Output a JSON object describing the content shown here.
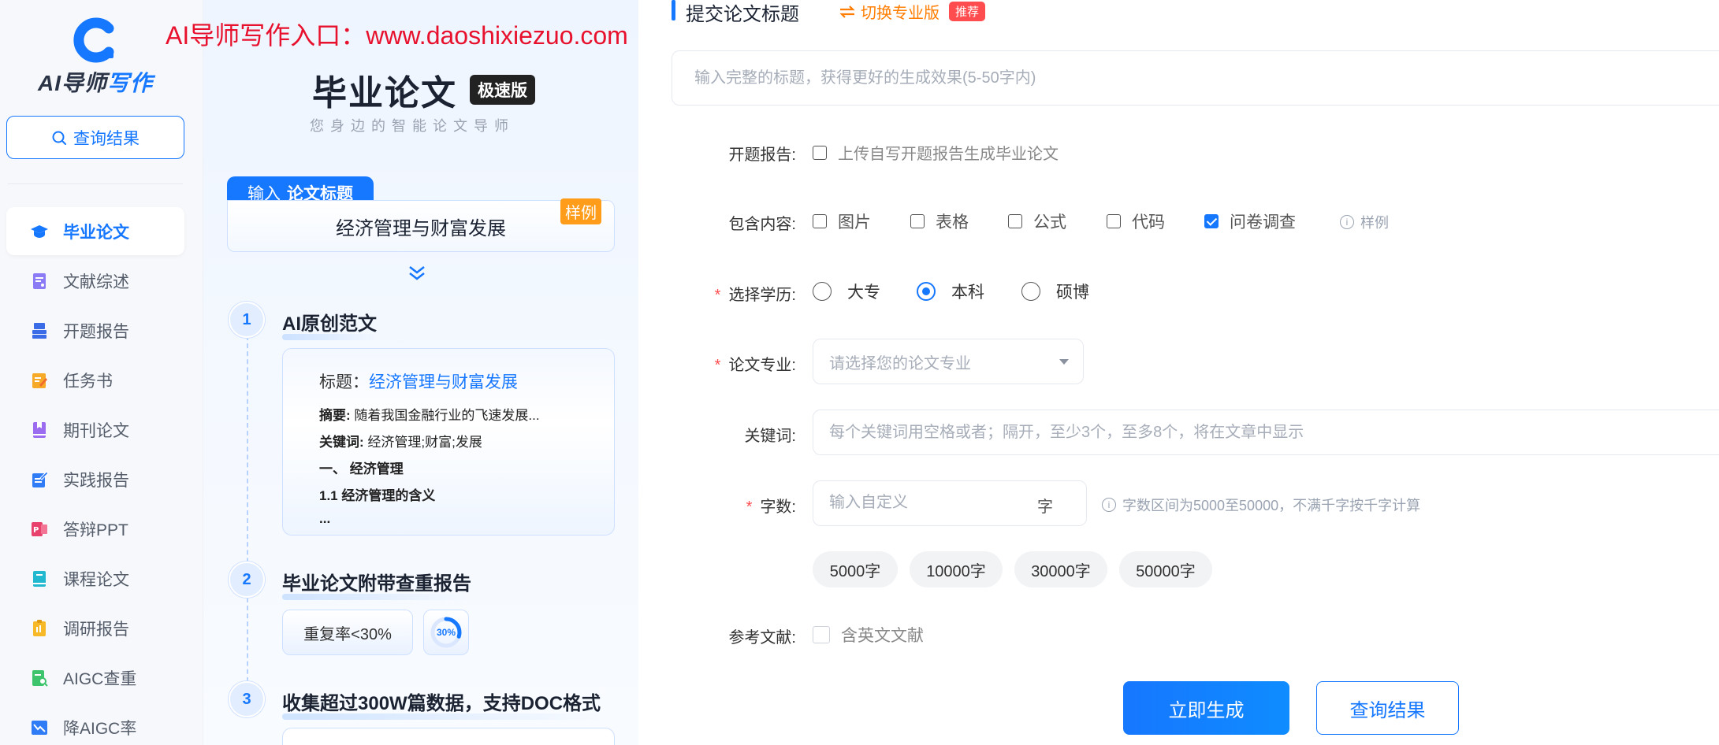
{
  "brand": {
    "logo_text_main": "AI导师",
    "logo_text_accent": "写作",
    "accent_color": "#1677ff"
  },
  "watermark": "AI导师写作入口：www.daoshixiezuo.com",
  "sidebar": {
    "query_button": "查询结果",
    "items": [
      {
        "label": "毕业论文",
        "icon": "graduation-cap-icon",
        "active": true
      },
      {
        "label": "文献综述",
        "icon": "document-list-icon"
      },
      {
        "label": "开题报告",
        "icon": "stack-report-icon"
      },
      {
        "label": "任务书",
        "icon": "task-edit-icon"
      },
      {
        "label": "期刊论文",
        "icon": "journal-book-icon"
      },
      {
        "label": "实践报告",
        "icon": "practice-edit-icon"
      },
      {
        "label": "答辩PPT",
        "icon": "ppt-icon"
      },
      {
        "label": "课程论文",
        "icon": "course-book-icon"
      },
      {
        "label": "调研报告",
        "icon": "clipboard-icon"
      },
      {
        "label": "AIGC查重",
        "icon": "aigc-check-icon"
      },
      {
        "label": "降AIGC率",
        "icon": "chart-down-icon"
      }
    ]
  },
  "promo": {
    "title": "毕业论文",
    "badge": "极速版",
    "subtitle": "您身边的智能论文导师",
    "input_tab_prefix": "输入",
    "input_tab_bold": "论文标题",
    "example_title": "经济管理与财富发展",
    "sample_tag": "样例",
    "steps": [
      {
        "num": "1",
        "title": "AI原创范文"
      },
      {
        "num": "2",
        "title": "毕业论文附带查重报告"
      },
      {
        "num": "3",
        "title": "收集超过300W篇数据，支持DOC格式"
      }
    ],
    "article": {
      "title_label": "标题：",
      "title_value": "经济管理与财富发展",
      "abstract_label": "摘要:",
      "abstract_value": "随着我国金融行业的飞速发展...",
      "keywords_label": "关键词:",
      "keywords_value": "经济管理;财富;发展",
      "heading1": "一、 经济管理",
      "heading2": "1.1 经济管理的含义",
      "ellipsis": "..."
    },
    "rate_text": "重复率<30%",
    "rate_ring_label": "30%",
    "rate_ring_value": 0.3
  },
  "form": {
    "section_title": "提交论文标题",
    "switch_label": "切换专业版",
    "recommend_badge": "推荐",
    "title_placeholder": "输入完整的标题，获得更好的生成效果(5-50字内)",
    "proposal": {
      "label": "开题报告:",
      "option": "上传自写开题报告生成毕业论文"
    },
    "contents": {
      "label": "包含内容:",
      "options": [
        {
          "label": "图片",
          "checked": false
        },
        {
          "label": "表格",
          "checked": false
        },
        {
          "label": "公式",
          "checked": false
        },
        {
          "label": "代码",
          "checked": false
        },
        {
          "label": "问卷调查",
          "checked": true
        }
      ],
      "example_link": "样例"
    },
    "degree": {
      "label": "选择学历:",
      "options": [
        "大专",
        "本科",
        "硕博"
      ],
      "selected": "本科"
    },
    "major": {
      "label": "论文专业:",
      "placeholder": "请选择您的论文专业"
    },
    "keywords": {
      "label": "关键词:",
      "placeholder": "每个关键词用空格或者；隔开，至少3个，至多8个，将在文章中显示"
    },
    "word_count": {
      "label": "字数:",
      "placeholder": "输入自定义",
      "unit": "字",
      "hint": "字数区间为5000至50000，不满千字按千字计算",
      "presets": [
        "5000字",
        "10000字",
        "30000字",
        "50000字"
      ]
    },
    "references": {
      "label": "参考文献:",
      "option": "含英文文献"
    },
    "generate_button": "立即生成",
    "query_button": "查询结果"
  }
}
